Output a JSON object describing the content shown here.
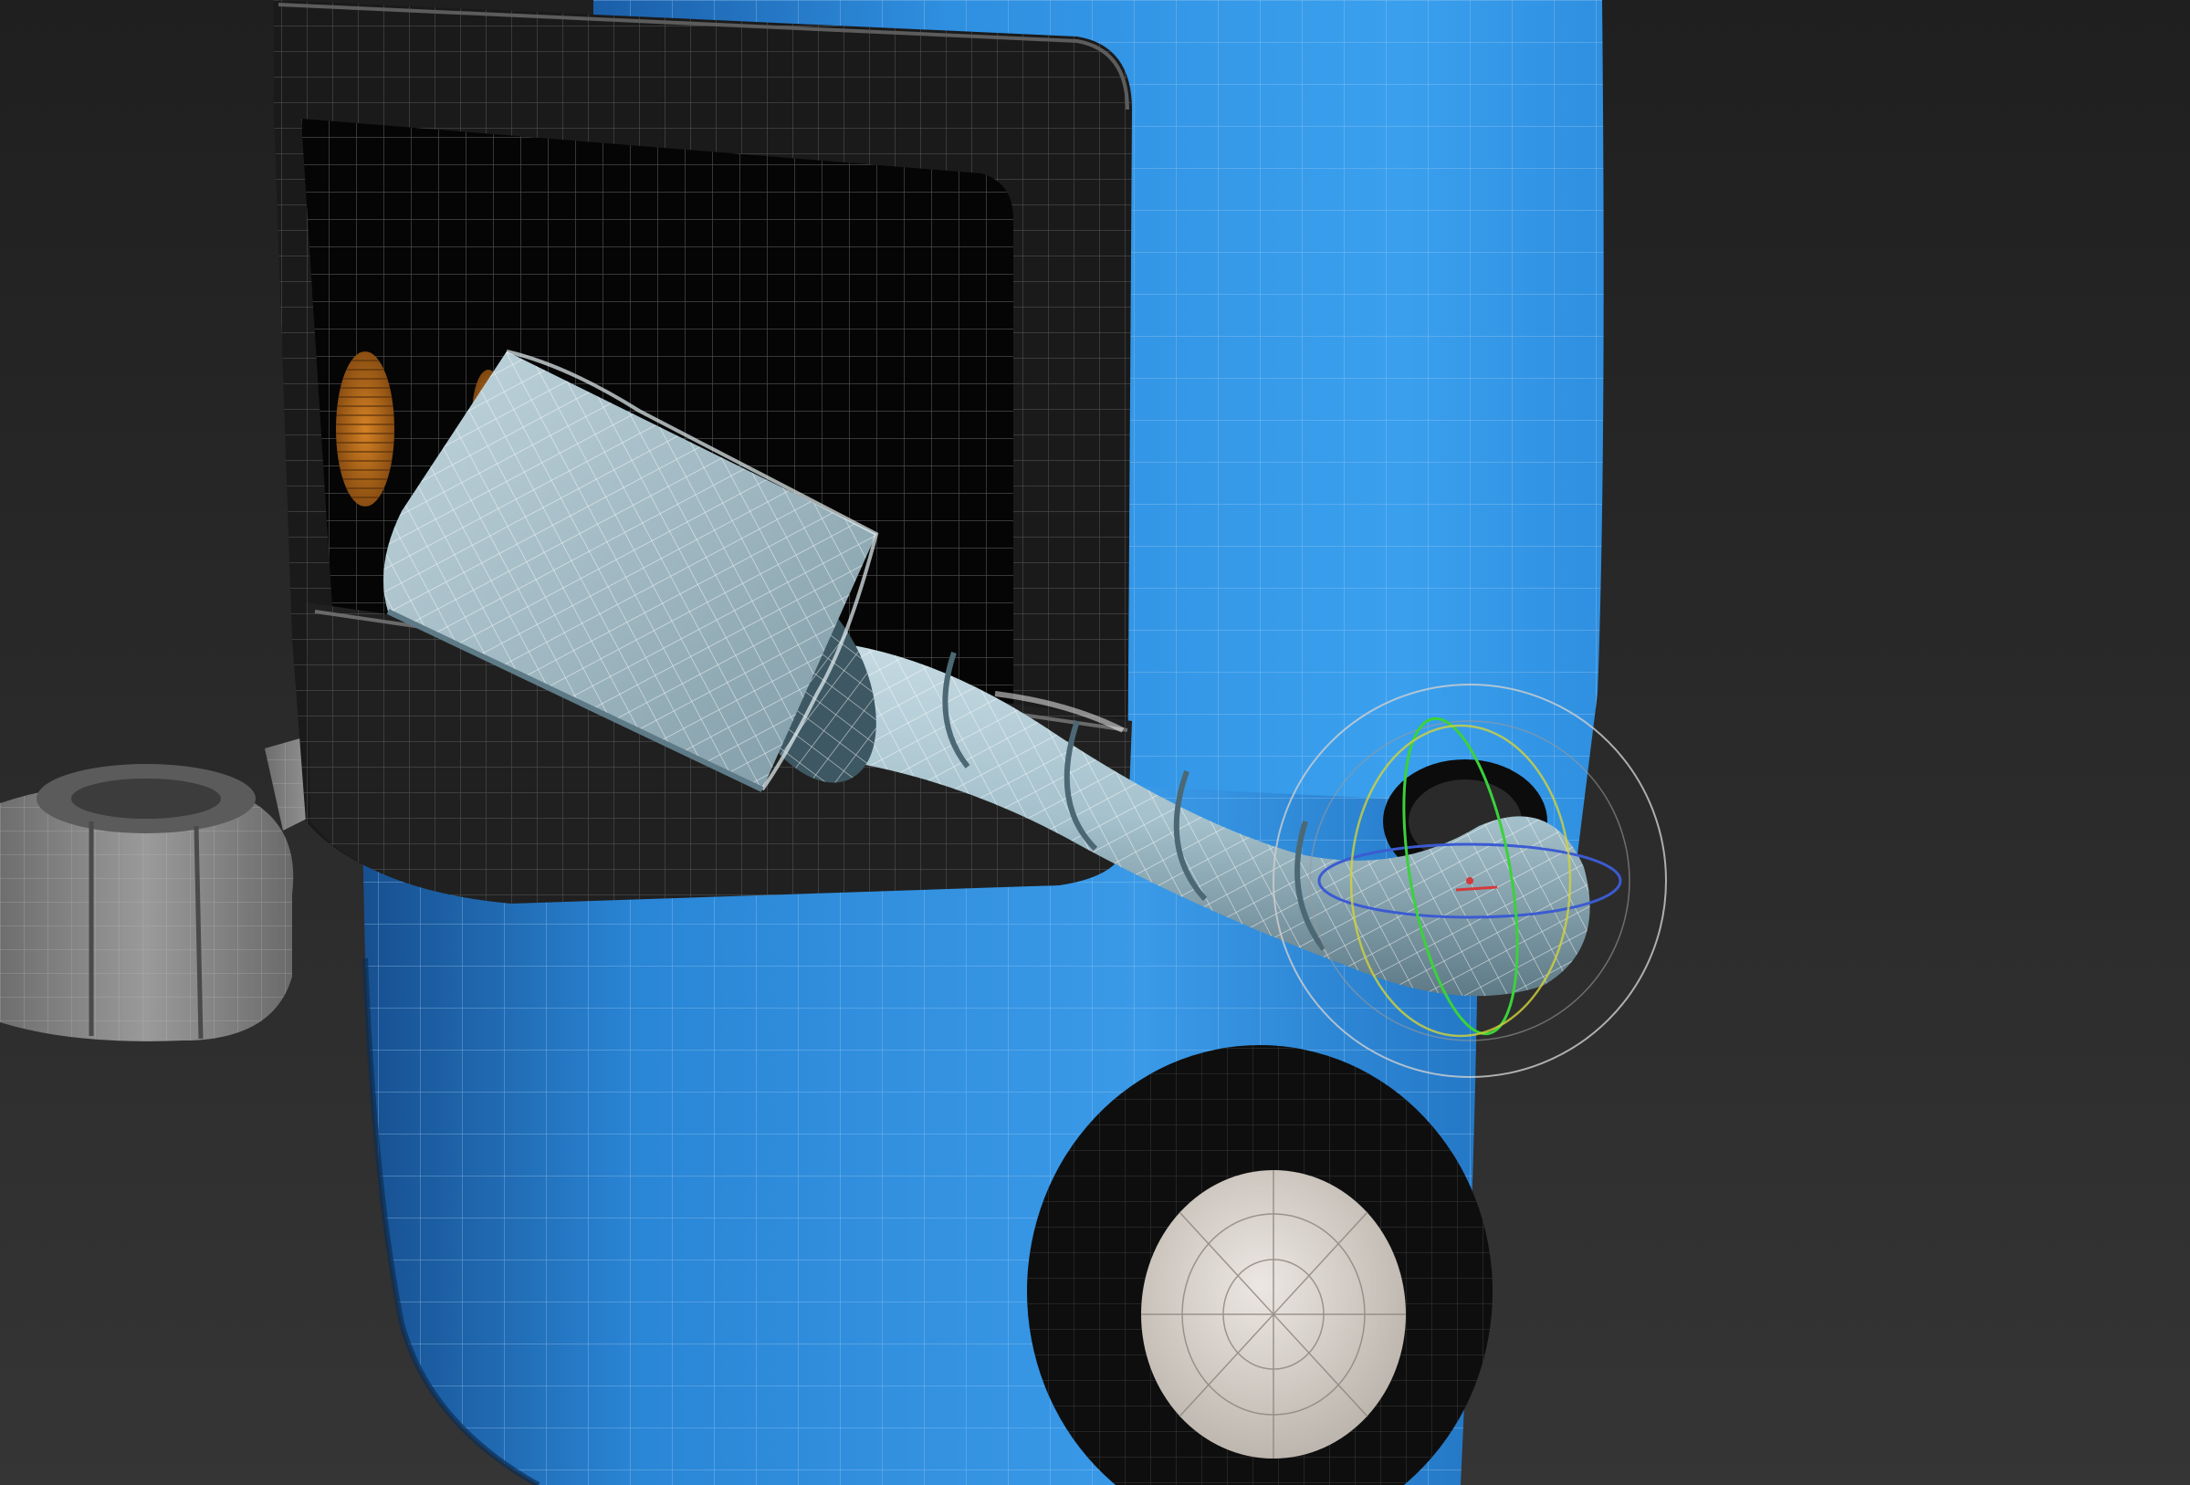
{
  "viewport": {
    "mode": "perspective-3d-viewport",
    "shading": "smooth-shaded-with-wireframe-edges",
    "background_top": "#1f1f1f",
    "background_bottom": "#353535"
  },
  "scene": {
    "subject": "vacuum-robot-model",
    "colors": {
      "body_blue": "#2f8fe0",
      "body_blue_dark": "#1d6fc0",
      "frame_black": "#1a1a1a",
      "grille_black": "#050505",
      "hose_light": "#a9c4cf",
      "hose_dark": "#5e7a86",
      "side_gray": "#8c8c8c",
      "wheel_tire": "#101010",
      "wheel_hub": "#d8d2cc",
      "light_orange": "#c9761c",
      "wire_light": "#ffffff"
    }
  },
  "gizmo": {
    "type": "rotate-gizmo",
    "active": true,
    "colors": {
      "outer": "#cfcfcf",
      "x_axis": "#d23b3b",
      "y_axis": "#3bd23b",
      "z_axis": "#3b5bd2",
      "view": "#d2d23b"
    }
  }
}
